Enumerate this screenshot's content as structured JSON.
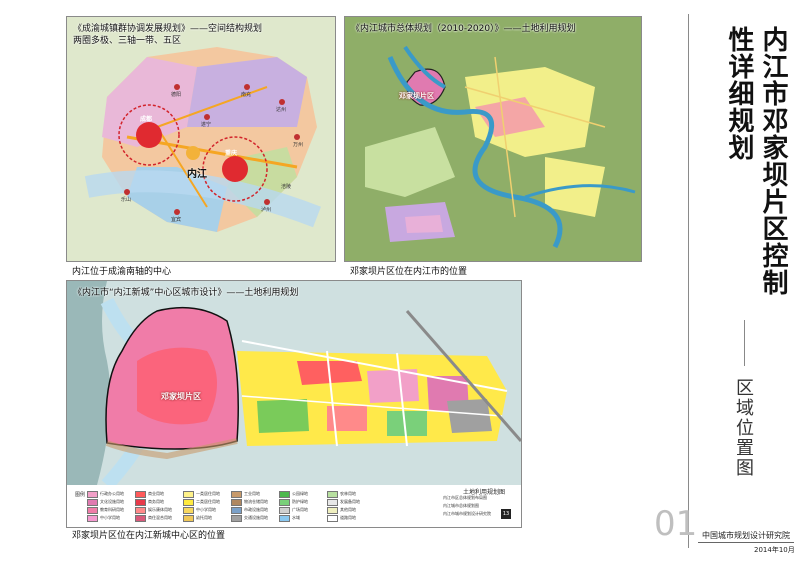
{
  "sidebar": {
    "main_title": "内江市邓家坝片区控制性详细规划",
    "sub_title": "区域位置图",
    "page_number": "01",
    "institute": "中国城市规划设计研究院",
    "date": "2014年10月"
  },
  "panel1": {
    "title": "《成渝城镇群协调发展规划》——空间结构规划",
    "subtitle": "两圈多极、三轴一带、五区",
    "caption": "内江位于成渝南轴的中心",
    "labels": {
      "chengdu": "成都",
      "neijiang": "内江",
      "chongqing": "重庆",
      "deyang": "德阳",
      "nanchong": "南充",
      "dazhou": "达州",
      "suining": "遂宁",
      "leshan": "乐山",
      "yibin": "宜宾",
      "luzhou": "泸州",
      "wanzhou": "万州",
      "fuling": "涪陵"
    }
  },
  "panel2": {
    "title": "《内江城市总体规划（2010-2020）》——土地利用规划",
    "area_label": "邓家坝片区",
    "caption": "邓家坝片区位在内江市的位置"
  },
  "panel3": {
    "title": "《内江市“内江新城”中心区城市设计》——土地利用规划",
    "area_label": "邓家坝片区",
    "map_title": "土地利用规划图",
    "caption": "邓家坝片区位在内江新城中心区的位置",
    "legend_heading": "图例",
    "legend_cols": [
      [
        {
          "t": "行政办公用地",
          "c": "#f2a0c8"
        },
        {
          "t": "文化设施用地",
          "c": "#e07ab0"
        },
        {
          "t": "教育科研用地",
          "c": "#f07ca8"
        },
        {
          "t": "中小学用地",
          "c": "#f59ad0"
        }
      ],
      [
        {
          "t": "商业用地",
          "c": "#ff5a5a"
        },
        {
          "t": "商务用地",
          "c": "#e83a4a"
        },
        {
          "t": "娱乐康体用地",
          "c": "#ff8a8a"
        },
        {
          "t": "商住混合用地",
          "c": "#d85a7a"
        }
      ],
      [
        {
          "t": "一类居住用地",
          "c": "#fff28a"
        },
        {
          "t": "二类居住用地",
          "c": "#ffea40"
        },
        {
          "t": "中小学用地",
          "c": "#f8d860"
        },
        {
          "t": "幼托用地",
          "c": "#f0c858"
        }
      ],
      [
        {
          "t": "工业用地",
          "c": "#c89a6a"
        },
        {
          "t": "物流仓储用地",
          "c": "#b08860"
        },
        {
          "t": "市政设施用地",
          "c": "#7aa0c8"
        },
        {
          "t": "交通设施用地",
          "c": "#a0a0a0"
        }
      ],
      [
        {
          "t": "公园绿地",
          "c": "#4cb84c"
        },
        {
          "t": "防护绿地",
          "c": "#7ad07a"
        },
        {
          "t": "广场用地",
          "c": "#d0d0d0"
        },
        {
          "t": "水域",
          "c": "#8ac8f0"
        }
      ],
      [
        {
          "t": "农林用地",
          "c": "#b8e0a0"
        },
        {
          "t": "发展备用地",
          "c": "#e8e8e8"
        },
        {
          "t": "其他用地",
          "c": "#f0f0c0"
        },
        {
          "t": "道路用地",
          "c": "#ffffff"
        }
      ]
    ],
    "notes": [
      "内江市区总体规划布局图",
      "内江城市总体规划图",
      "内江市城市规划设计研究院"
    ],
    "page_badge": "13"
  }
}
